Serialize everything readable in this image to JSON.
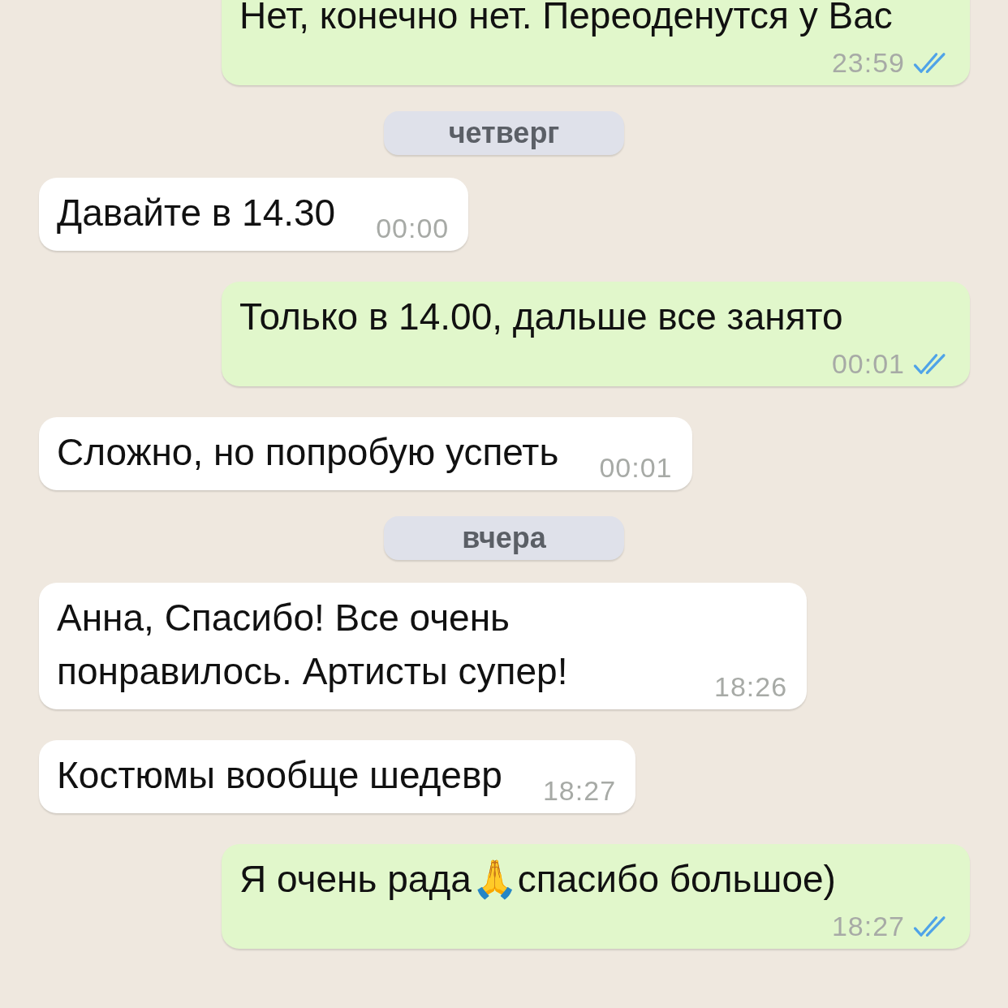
{
  "messages": [
    {
      "kind": "message",
      "outgoing": true,
      "text": "Нет, конечно нет. Переоденутся у Вас",
      "time": "23:59",
      "read": true
    },
    {
      "kind": "date",
      "text": "четверг"
    },
    {
      "kind": "message",
      "outgoing": false,
      "text": "Давайте в 14.30",
      "time": "00:00"
    },
    {
      "kind": "message",
      "outgoing": true,
      "text": "Только в 14.00, дальше все занято",
      "time": "00:01",
      "read": true
    },
    {
      "kind": "message",
      "outgoing": false,
      "text": "Сложно, но попробую успеть",
      "time": "00:01"
    },
    {
      "kind": "date",
      "text": "вчера"
    },
    {
      "kind": "message",
      "outgoing": false,
      "text": "Анна, Спасибо! Все очень понравилось. Артисты супер!",
      "time": "18:26"
    },
    {
      "kind": "message",
      "outgoing": false,
      "text": "Костюмы вообще шедевр",
      "time": "18:27"
    },
    {
      "kind": "message",
      "outgoing": true,
      "text": "Я очень рада🙏спасибо большое)",
      "time": "18:27",
      "read": true
    }
  ]
}
